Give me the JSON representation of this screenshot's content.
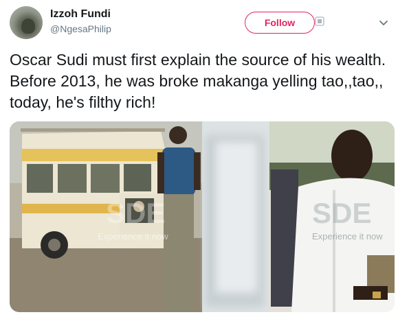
{
  "tweet": {
    "author_name": "Izzoh Fundi",
    "author_handle": "@NgesaPhilip",
    "follow_label": "Follow",
    "text": "Oscar Sudi must first explain the source of his wealth. Before 2013, he was broke makanga yelling tao,,tao,, today, he's filthy rich!"
  },
  "media": {
    "watermark_left": "Experience it now",
    "watermark_right": "Experience it now"
  },
  "colors": {
    "follow_accent": "#e0245e",
    "text_primary": "#14171a",
    "text_secondary": "#657786"
  },
  "icons": {
    "follow_side": "follow-settings-icon",
    "menu": "chevron-down-icon"
  }
}
